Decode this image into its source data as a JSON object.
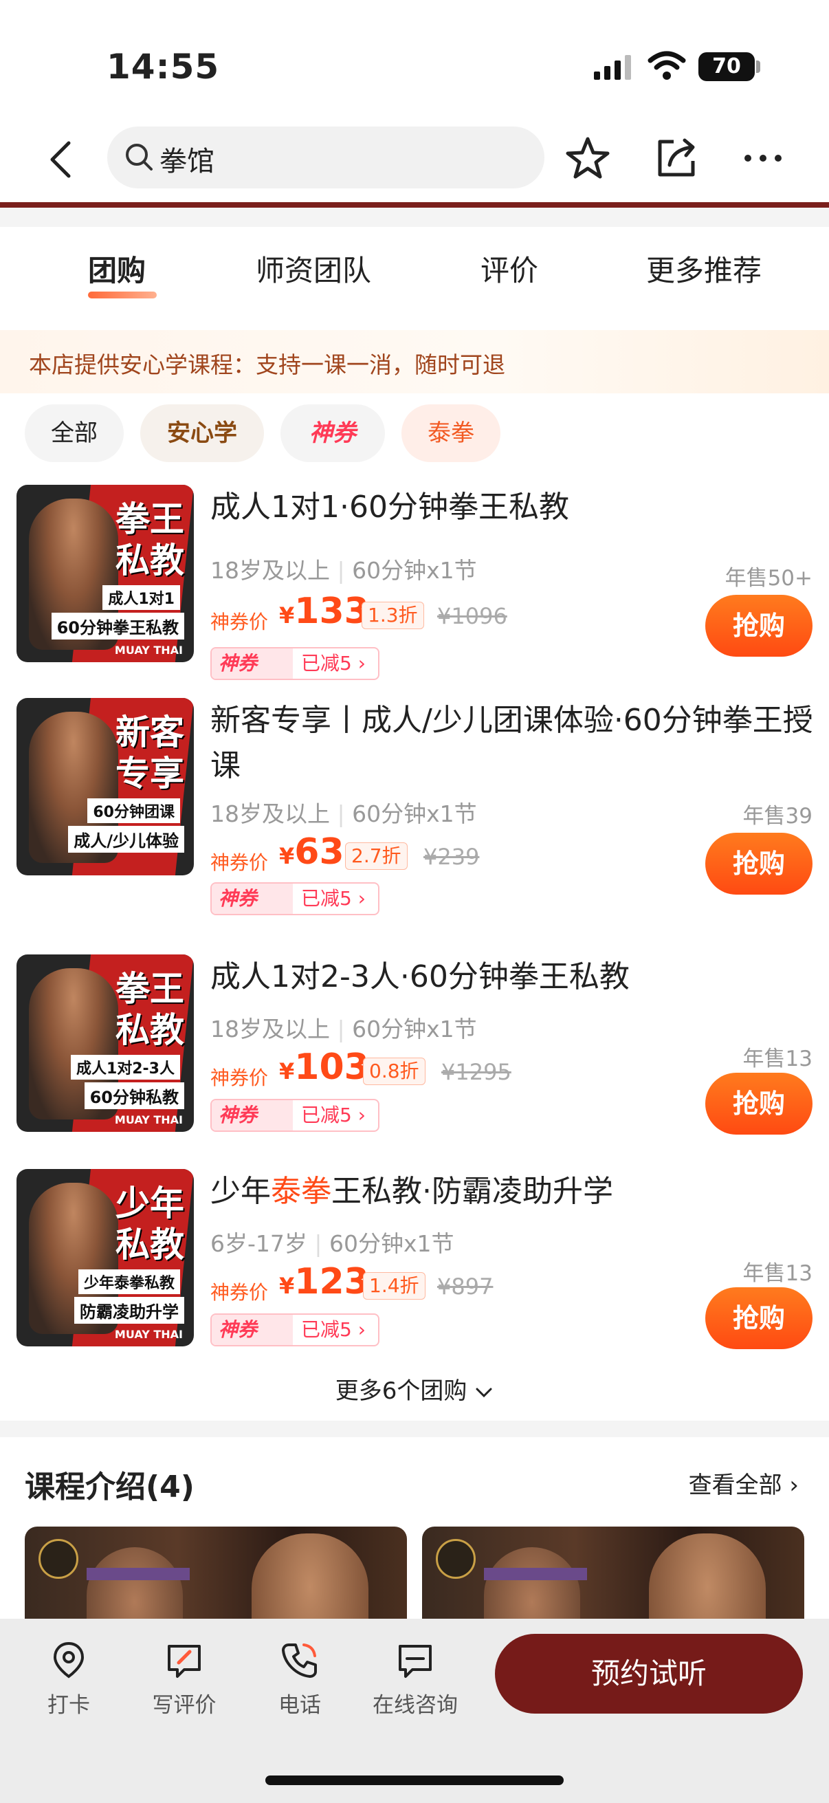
{
  "status": {
    "time": "14:55",
    "battery": "70"
  },
  "nav": {
    "search_text": "拳馆"
  },
  "tabs": [
    "团购",
    "师资团队",
    "评价",
    "更多推荐"
  ],
  "notice": "本店提供安心学课程：支持一课一消，随时可退",
  "chips": [
    "全部",
    "安心学",
    "神券",
    "泰拳"
  ],
  "deals": [
    {
      "thumb_big": "拳王私教",
      "thumb_l1": "成人1对1",
      "thumb_l2": "60分钟拳王私教",
      "brand": "MUAY THAI",
      "title": "成人1对1·60分钟拳王私教",
      "age": "18岁及以上",
      "dur": "60分钟x1节",
      "price_label": "神券价",
      "currency": "¥",
      "price": "133",
      "discount": "1.3折",
      "orig": "¥1096",
      "tag1": "神券",
      "tag2": "已减5",
      "sold": "年售50+",
      "buy": "抢购"
    },
    {
      "thumb_big": "新客专享",
      "thumb_l1": "60分钟团课",
      "thumb_l2": "成人/少儿体验",
      "brand": "",
      "title": "新客专享丨成人/少儿团课体验·60分钟拳王授课",
      "age": "18岁及以上",
      "dur": "60分钟x1节",
      "price_label": "神券价",
      "currency": "¥",
      "price": "63",
      "discount": "2.7折",
      "orig": "¥239",
      "tag1": "神券",
      "tag2": "已减5",
      "sold": "年售39",
      "buy": "抢购"
    },
    {
      "thumb_big": "拳王私教",
      "thumb_l1": "成人1对2-3人",
      "thumb_l2": "60分钟私教",
      "brand": "MUAY THAI",
      "title": "成人1对2-3人·60分钟拳王私教",
      "age": "18岁及以上",
      "dur": "60分钟x1节",
      "price_label": "神券价",
      "currency": "¥",
      "price": "103",
      "discount": "0.8折",
      "orig": "¥1295",
      "tag1": "神券",
      "tag2": "已减5",
      "sold": "年售13",
      "buy": "抢购"
    },
    {
      "thumb_big": "少年私教",
      "thumb_l1": "少年泰拳私教",
      "thumb_l2": "防霸凌助升学",
      "brand": "MUAY THAI",
      "title_pre": "少年",
      "title_hl": "泰拳",
      "title_post": "王私教·防霸凌助升学",
      "age": "6岁-17岁",
      "dur": "60分钟x1节",
      "price_label": "神券价",
      "currency": "¥",
      "price": "123",
      "discount": "1.4折",
      "orig": "¥897",
      "tag1": "神券",
      "tag2": "已减5",
      "sold": "年售13",
      "buy": "抢购"
    }
  ],
  "more_deals": "更多6个团购",
  "course": {
    "title": "课程介绍(4)",
    "view_all": "查看全部"
  },
  "bottom": {
    "checkin": "打卡",
    "review": "写评价",
    "phone": "电话",
    "consult": "在线咨询",
    "reserve": "预约试听"
  },
  "colors": {
    "brand": "#761b19",
    "accent": "#ff4a17",
    "coupon": "#ff3a56"
  }
}
